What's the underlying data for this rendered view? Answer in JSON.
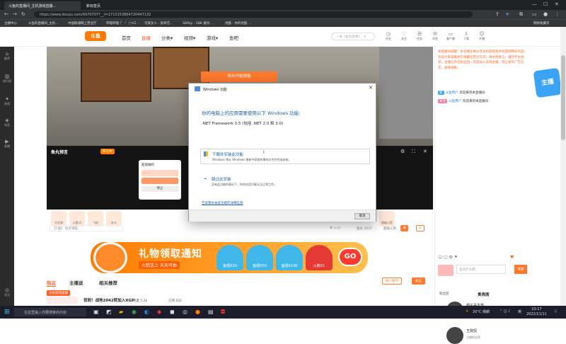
{
  "browser": {
    "tabs": [
      "斗鱼的直播间_主机游戏直播…",
      "新标签页"
    ],
    "url": "https://www.douyu.com/9970707?__t=1713153864720447132",
    "bookmarks": [
      "主播中心",
      "斗鱼的直播间_主机…",
      "中国联通网上营业厅",
      "哔哩哔哩 (゜-゜)つロ…",
      "可爱女人 - 爱奇艺…",
      "SDPay - SDK 服务…",
      "优酷 - 你的优酷 …",
      "网络收藏夹"
    ]
  },
  "header": {
    "logo": "斗鱼",
    "nav": [
      "首页",
      "直播",
      "分类▾",
      "视频▾",
      "游戏▾",
      "鱼吧"
    ],
    "search_placeholder": "一本《鱼丸指南》",
    "icons": [
      "历史",
      "关注",
      "任务",
      "消息",
      "客户端",
      "下载",
      "开播"
    ]
  },
  "sidebar": [
    "推荐",
    "排行榜",
    "游戏",
    "电竞",
    "直播",
    "关注"
  ],
  "video": {
    "overlay_button": "双击开始观看"
  },
  "player": {
    "title": "鱼丸预言",
    "badge": "参与中",
    "card_title": "超值抽鸣",
    "card_bar": "……",
    "card_stop": "停止"
  },
  "gifts": [
    "大礼物",
    "火箭x1",
    "飞机",
    "办卡",
    "超级火箭"
  ],
  "chat_placeholder": "【1倍】 您可领取…",
  "status": [
    "鱼丸 2537",
    "超级火箭"
  ],
  "banner": {
    "title": "礼物领取通知",
    "subtitle": "火箭送上 天天可抽",
    "tickets": [
      "鱼翅X20",
      "鱼翅X50",
      "鱼翅X100",
      "火箭X1"
    ],
    "go": "GO"
  },
  "page_tabs": [
    "热议",
    "主播说",
    "相关推荐"
  ],
  "page_buttons": [
    "加入看点",
    "关注"
  ],
  "room": {
    "badge": "主机游戏直播",
    "title": "背刺！战地2042转加入XGP",
    "meta": [
      "热度 5.2k",
      "订阅 102"
    ]
  },
  "right_panel": {
    "notice": "本直播间提醒：本主播主要分享主机游戏及单机游戏精彩内容，欢迎大家观看并在弹幕区友好交流，请文明发言，遵守平台规则，主播已开启粉丝团，欢迎加入支持主播，禁止发布广告信息，谢谢观看。",
    "chat": [
      {
        "badge": "新",
        "name": "斗鱼用户",
        "text": "欢迎来到本直播间"
      },
      {
        "badge": "关注",
        "name": "斗鱼用户",
        "text": "欢迎来到本直播间"
      }
    ],
    "input_placeholder": "说点什么吧…",
    "send": "发送",
    "fans_tab": "粉丝团",
    "fans_tab2": "贵宾席",
    "fans": [
      {
        "name": "帽子哥本尊",
        "sub": "主播粉丝榜"
      },
      {
        "name": "王院侃",
        "sub": "主播粉丝榜"
      }
    ]
  },
  "dialog": {
    "title": "Windows 功能",
    "heading": "你的电脑上的应用需要使用以下 Windows 功能:",
    "feature": ".NET Framework 3.5 (包括 .NET 2.0 和 3.0)",
    "options": [
      {
        "title": "下载并安装此功能",
        "desc": "Windows 将从 Windows 更新中获取所需的文件并完成安装。"
      },
      {
        "title": "跳过此安装",
        "desc": "没有此功能的情况下，你的应用可能无法正常工作。"
      }
    ],
    "link": "告诉我有关此功能的详细信息",
    "cancel": "取消"
  },
  "mascot": "主播",
  "taskbar": {
    "search": "在这里输入你要搜索的内容",
    "weather": "20°C 晴朗",
    "lang": "英",
    "time": "23:17",
    "date": "2022/11/11"
  }
}
